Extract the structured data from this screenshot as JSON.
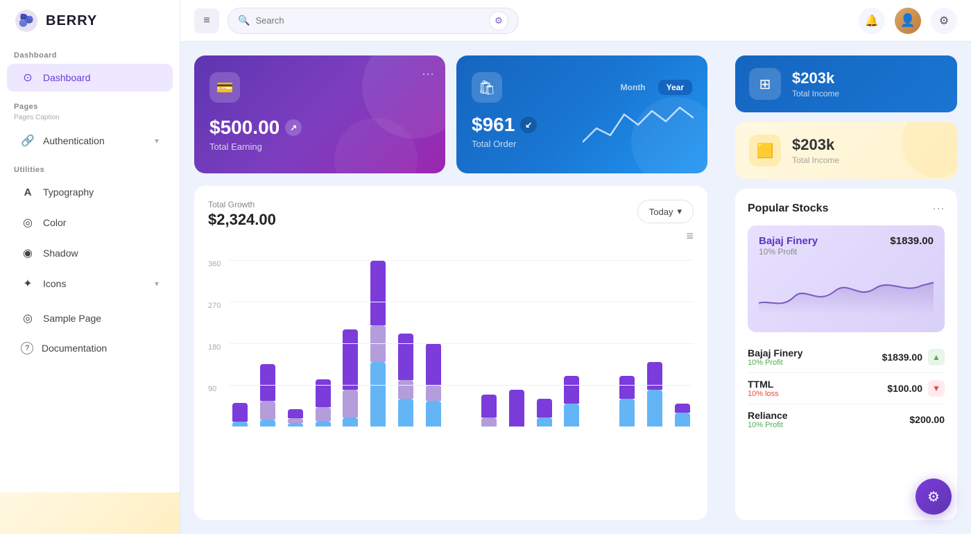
{
  "app": {
    "logo_text": "BERRY",
    "logo_emoji": "🫐"
  },
  "sidebar": {
    "sections": [
      {
        "label": "Dashboard",
        "items": [
          {
            "id": "dashboard",
            "label": "Dashboard",
            "icon": "⊙",
            "active": true
          }
        ]
      },
      {
        "label": "Pages",
        "caption": "Pages Caption",
        "items": [
          {
            "id": "authentication",
            "label": "Authentication",
            "icon": "🔗",
            "chevron": true
          }
        ]
      },
      {
        "label": "Utilities",
        "items": [
          {
            "id": "typography",
            "label": "Typography",
            "icon": "A"
          },
          {
            "id": "color",
            "label": "Color",
            "icon": "◎"
          },
          {
            "id": "shadow",
            "label": "Shadow",
            "icon": "◉"
          },
          {
            "id": "icons",
            "label": "Icons",
            "icon": "✦",
            "chevron": true
          }
        ]
      },
      {
        "label": "",
        "items": [
          {
            "id": "sample-page",
            "label": "Sample Page",
            "icon": "◎"
          },
          {
            "id": "documentation",
            "label": "Documentation",
            "icon": "?"
          }
        ]
      }
    ]
  },
  "header": {
    "search_placeholder": "Search",
    "hamburger_label": "≡",
    "filter_icon": "⚙"
  },
  "cards": {
    "earning": {
      "amount": "$500.00",
      "label": "Total Earning",
      "icon": "💳"
    },
    "order": {
      "amount": "$961",
      "label": "Total Order",
      "icon": "🛍",
      "toggle": {
        "month": "Month",
        "year": "Year",
        "active": "Year"
      }
    },
    "total_income_blue": {
      "amount": "$203k",
      "label": "Total Income",
      "icon": "📊"
    },
    "total_income_yellow": {
      "amount": "$203k",
      "label": "Total Income",
      "icon": "🟨"
    }
  },
  "chart": {
    "title": "Total Growth",
    "amount": "$2,324.00",
    "period_btn": "Today",
    "y_labels": [
      "360",
      "270",
      "180",
      "90"
    ],
    "bars": [
      {
        "purple": 40,
        "light_purple": 0,
        "blue": 10,
        "total": 50
      },
      {
        "purple": 80,
        "light_purple": 40,
        "blue": 15,
        "total": 135
      },
      {
        "purple": 20,
        "light_purple": 10,
        "blue": 8,
        "total": 38
      },
      {
        "purple": 60,
        "light_purple": 30,
        "blue": 12,
        "total": 102
      },
      {
        "purple": 130,
        "light_purple": 60,
        "blue": 20,
        "total": 210
      },
      {
        "purple": 140,
        "light_purple": 80,
        "blue": 140,
        "total": 360
      },
      {
        "purple": 100,
        "light_purple": 40,
        "blue": 60,
        "total": 200
      },
      {
        "purple": 90,
        "light_purple": 35,
        "blue": 55,
        "total": 180
      },
      {
        "purple": 0,
        "light_purple": 0,
        "blue": 0,
        "total": 0
      },
      {
        "purple": 50,
        "light_purple": 20,
        "blue": 0,
        "total": 70
      },
      {
        "purple": 80,
        "light_purple": 0,
        "blue": 0,
        "total": 80
      },
      {
        "purple": 40,
        "light_purple": 0,
        "blue": 20,
        "total": 60
      },
      {
        "purple": 60,
        "light_purple": 0,
        "blue": 50,
        "total": 110
      },
      {
        "purple": 0,
        "light_purple": 0,
        "blue": 0,
        "total": 0
      },
      {
        "purple": 50,
        "light_purple": 0,
        "blue": 60,
        "total": 110
      },
      {
        "purple": 60,
        "light_purple": 0,
        "blue": 80,
        "total": 140
      },
      {
        "purple": 20,
        "light_purple": 0,
        "blue": 30,
        "total": 50
      }
    ]
  },
  "stocks": {
    "title": "Popular Stocks",
    "featured": {
      "name": "Bajaj Finery",
      "price": "$1839.00",
      "profit_label": "10% Profit"
    },
    "list": [
      {
        "name": "Bajaj Finery",
        "price": "$1839.00",
        "change": "up",
        "profit_label": "10% Profit"
      },
      {
        "name": "TTML",
        "price": "$100.00",
        "change": "down",
        "profit_label": "10% loss"
      },
      {
        "name": "Reliance",
        "price": "$200.00",
        "change": "up",
        "profit_label": "10% Profit"
      }
    ]
  },
  "fab": {
    "icon": "⚙"
  }
}
